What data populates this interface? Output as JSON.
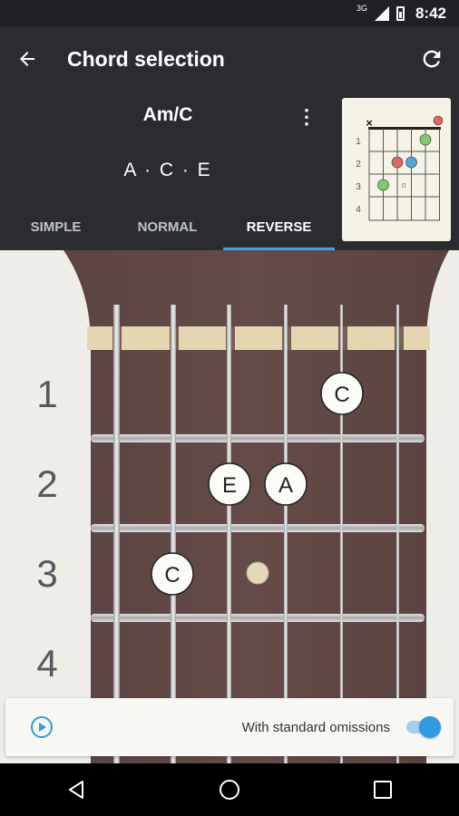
{
  "status_bar": {
    "network": "3G",
    "time": "8:42"
  },
  "app_bar": {
    "title": "Chord selection",
    "back_icon": "arrow-left-icon",
    "refresh_icon": "refresh-icon"
  },
  "chord": {
    "name": "Am/C",
    "notes": "A · C · E",
    "tabs": [
      {
        "label": "SIMPLE",
        "active": false
      },
      {
        "label": "NORMAL",
        "active": false
      },
      {
        "label": "REVERSE",
        "active": true
      }
    ]
  },
  "mini_chart": {
    "fret_labels": [
      "1",
      "2",
      "3",
      "4"
    ],
    "muted_marker": "×",
    "open_marker": "o"
  },
  "fretboard": {
    "fret_numbers": [
      "1",
      "2",
      "3",
      "4"
    ],
    "notes": [
      {
        "label": "C",
        "fret": 1,
        "string": 5
      },
      {
        "label": "E",
        "fret": 2,
        "string": 3
      },
      {
        "label": "A",
        "fret": 2,
        "string": 4
      },
      {
        "label": "C",
        "fret": 3,
        "string": 1
      }
    ],
    "inlay_fret": 3
  },
  "omissions": {
    "label": "With standard omissions",
    "enabled": true
  },
  "colors": {
    "accent": "#3aa4e8",
    "toolbar": "#2a2c30",
    "wood": "#5e4744"
  }
}
